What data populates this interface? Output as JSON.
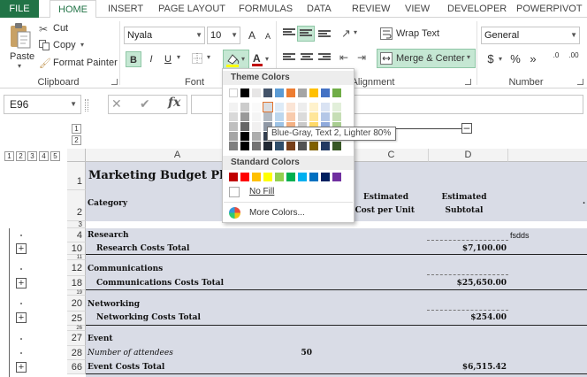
{
  "tabs": [
    "FILE",
    "HOME",
    "INSERT",
    "PAGE LAYOUT",
    "FORMULAS",
    "DATA",
    "REVIEW",
    "VIEW",
    "DEVELOPER",
    "POWERPIVOT"
  ],
  "ribbon": {
    "clipboard": {
      "paste": "Paste",
      "cut": "Cut",
      "copy": "Copy",
      "format_painter": "Format Painter",
      "group": "Clipboard"
    },
    "font": {
      "name": "Nyala",
      "size": "10",
      "group": "Font",
      "bold": "B",
      "italic": "I",
      "underline": "U",
      "grow": "A",
      "shrink": "A"
    },
    "alignment": {
      "wrap_text": "Wrap Text",
      "merge_center": "Merge & Center",
      "group": "Alignment"
    },
    "number": {
      "format": "General",
      "group": "Number",
      "currency": "$",
      "percent": "%",
      "comma": "»",
      "inc": ".0",
      "dec": ".00"
    }
  },
  "formula_bar": {
    "name_box": "E96",
    "fx": "fx",
    "cancel": "✕",
    "enter": "✔"
  },
  "outline": {
    "col_levels": [
      "1",
      "2"
    ],
    "row_levels": [
      "1",
      "2",
      "3",
      "4",
      "5"
    ]
  },
  "columns": [
    "A",
    "C",
    "D"
  ],
  "rows": [
    "1",
    "2",
    "3",
    "4",
    "10",
    "11",
    "12",
    "18",
    "19",
    "20",
    "25",
    "26",
    "27",
    "28",
    "66"
  ],
  "sheet": {
    "title": "Marketing Budget Pla",
    "category": "Category",
    "est_cost_1": "Estimated",
    "est_cost_2": "Cost per Unit",
    "est_sub_1": "Estimated",
    "est_sub_2": "Subtotal",
    "research": "Research",
    "research_note": "fsdds",
    "research_total": "Research Costs Total",
    "research_total_val": "$7,100.00",
    "communications": "Communications",
    "communications_total": "Communications Costs Total",
    "communications_total_val": "$25,650.00",
    "networking": "Networking",
    "networking_total": "Networking Costs Total",
    "networking_total_val": "$254.00",
    "event": "Event",
    "attendees": "Number of attendees",
    "attendees_val": "50",
    "event_total": "Event Costs Total",
    "event_total_val": "$6,515.42"
  },
  "palette": {
    "theme_header": "Theme Colors",
    "standard_header": "Standard Colors",
    "no_fill": "No Fill",
    "more_colors": "More Colors...",
    "tooltip": "Blue-Gray, Text 2, Lighter 80%",
    "theme_row": [
      "#ffffff",
      "#000000",
      "#e7e6e6",
      "#44546a",
      "#5b9bd5",
      "#ed7d31",
      "#a5a5a5",
      "#ffc000",
      "#4472c4",
      "#70ad47"
    ],
    "standard": [
      "#c00000",
      "#ff0000",
      "#ffc000",
      "#ffff00",
      "#92d050",
      "#00b050",
      "#00b0f0",
      "#0070c0",
      "#002060",
      "#7030a0"
    ]
  },
  "colors": {
    "excel_green": "#217346",
    "band": "#d9dce6"
  }
}
